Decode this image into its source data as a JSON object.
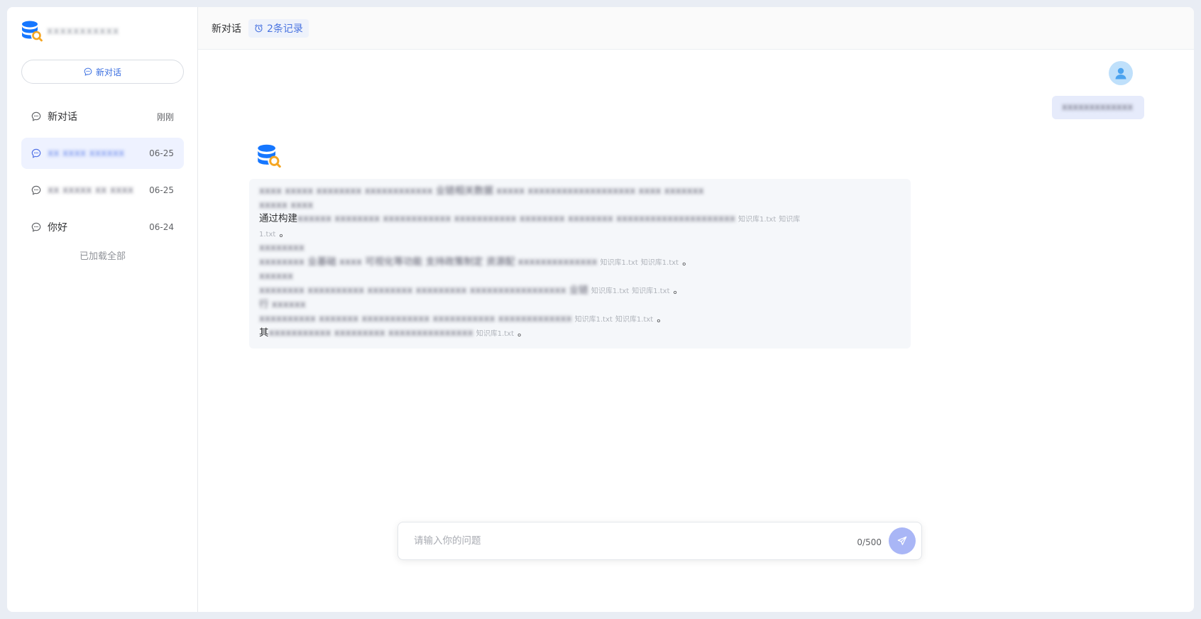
{
  "brand": {
    "name": "xxxxxxxxxxx"
  },
  "sidebar": {
    "new_chat_label": "新对话",
    "items": [
      {
        "title": "新对话",
        "date": "刚刚",
        "blurred": false
      },
      {
        "title": "xx xxxx xxxxxx",
        "date": "06-25",
        "blurred": true
      },
      {
        "title": "xx xxxxx xx xxxx",
        "date": "06-25",
        "blurred": true
      },
      {
        "title": "你好",
        "date": "06-24",
        "blurred": false
      }
    ],
    "loaded_all": "已加载全部"
  },
  "header": {
    "title": "新对话",
    "record_badge": "2条记录"
  },
  "chat": {
    "user_message": "xxxxxxxxxxxxx",
    "answer": {
      "line1": "xxxx xxxxx xxxxxxxx xxxxxxxxxxxx 业链相关数据 xxxxx xxxxxxxxxxxxxxxxxxx xxxx xxxxxxx",
      "line2": "xxxxx xxxx",
      "line3_prefix": "通过构建",
      "line3_rest": "xxxxxx xxxxxxxx xxxxxxxxxxxx xxxxxxxxxxx xxxxxxxx xxxxxxxx xxxxxxxxxxxxxxxxxxxxx",
      "line3_tail": "1.txt",
      "line4": "xxxxxxxx",
      "line5": "xxxxxxxx 业基础 xxxx 可视化等功能 支持政策制定 资源配 xxxxxxxxxxxxxx",
      "line6": "xxxxxx",
      "line7": "xxxxxxxx xxxxxxxxxx xxxxxxxx xxxxxxxxx xxxxxxxxxxxxxxxxx 业链",
      "line8": "行 xxxxxx",
      "line9": "xxxxxxxxxx xxxxxxx xxxxxxxxxxxx xxxxxxxxxxx xxxxxxxxxxxxx",
      "line10_prefix": "其",
      "line10_rest": "xxxxxxxxxxx xxxxxxxxx xxxxxxxxxxxxxxx",
      "ref": "知识库1.txt",
      "ref2": "知识库",
      "period": "。"
    }
  },
  "composer": {
    "placeholder": "请输入你的问题",
    "counter": "0/500"
  },
  "colors": {
    "accent": "#4a74e0",
    "active_bg": "#eef2ff",
    "send_btn": "#a9b6f6",
    "avatar_bg": "#bfe0fb"
  }
}
